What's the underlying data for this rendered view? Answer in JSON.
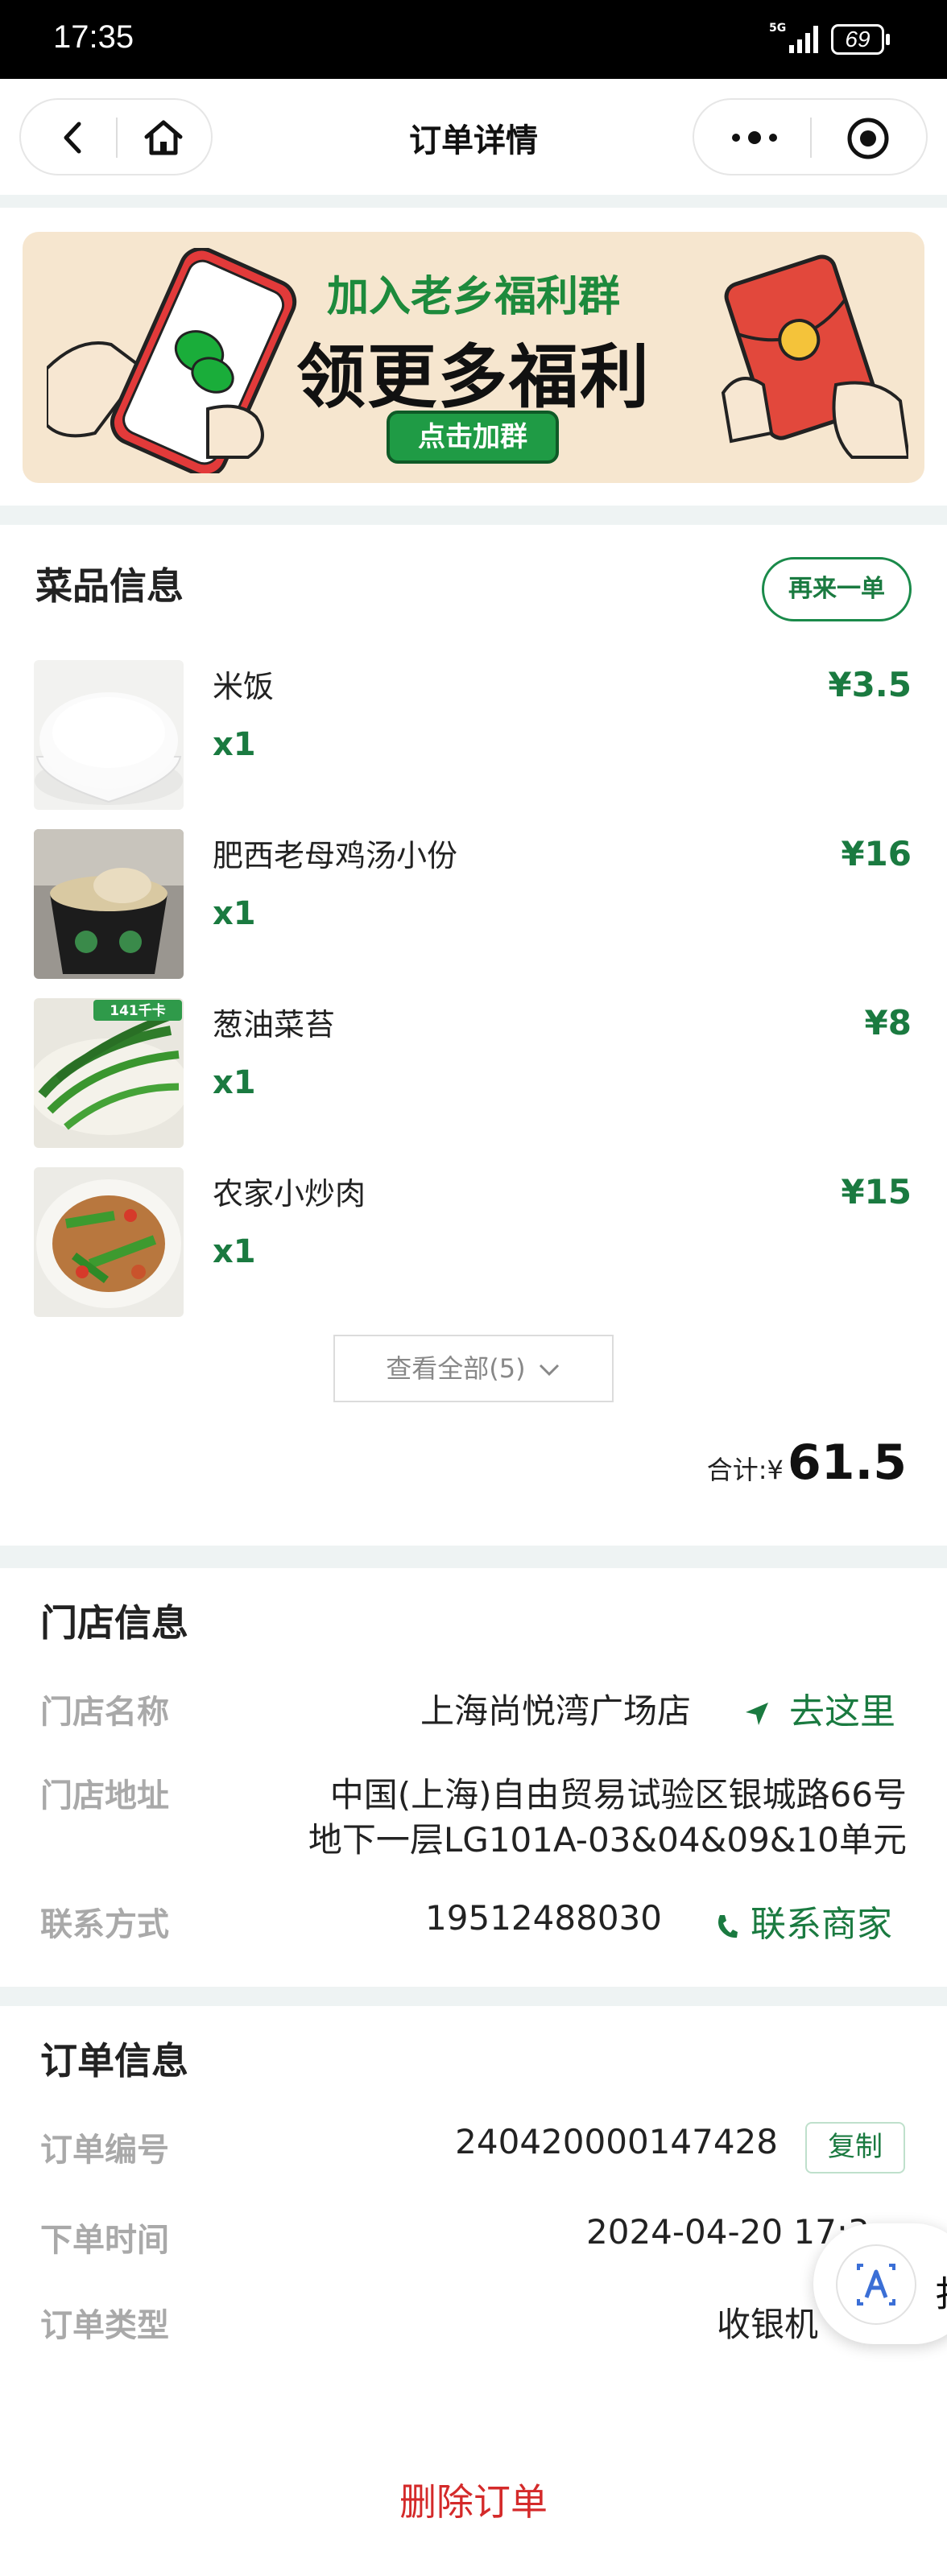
{
  "status_bar": {
    "time": "17:35",
    "network": "5G",
    "battery": "69"
  },
  "nav": {
    "title": "订单详情"
  },
  "banner": {
    "line1": "加入老乡福利群",
    "line2": "领更多福利",
    "button": "点击加群"
  },
  "dishes_section": {
    "title": "菜品信息",
    "reorder": "再来一单",
    "items": [
      {
        "name": "米饭",
        "qty": "x1",
        "price": "¥3.5"
      },
      {
        "name": "肥西老母鸡汤小份",
        "qty": "x1",
        "price": "¥16"
      },
      {
        "name": "葱油菜苔",
        "qty": "x1",
        "price": "¥8",
        "badge": "141千卡"
      },
      {
        "name": "农家小炒肉",
        "qty": "x1",
        "price": "¥15"
      }
    ],
    "view_all": "查看全部(5)",
    "total_label": "合计:",
    "total_symbol": "¥",
    "total_value": "61.5"
  },
  "store_section": {
    "title": "门店信息",
    "name_label": "门店名称",
    "name_value": "上海尚悦湾广场店",
    "goto": "去这里",
    "address_label": "门店地址",
    "address_line1": "中国(上海)自由贸易试验区银城路66号",
    "address_line2": "地下一层LG101A-03&04&09&10单元",
    "contact_label": "联系方式",
    "phone": "19512488030",
    "contact_merchant": "联系商家"
  },
  "order_section": {
    "title": "订单信息",
    "number_label": "订单编号",
    "number_value": "240420000147428",
    "copy": "复制",
    "time_label": "下单时间",
    "time_value": "2024-04-20 17:3",
    "type_label": "订单类型",
    "type_value": "收银机",
    "delete": "删除订单"
  },
  "floating": {
    "partial_text": "扌"
  },
  "colors": {
    "brand_green": "#1a7a40",
    "danger_red": "#d42a2a",
    "label_gray": "#a9a9a9"
  }
}
